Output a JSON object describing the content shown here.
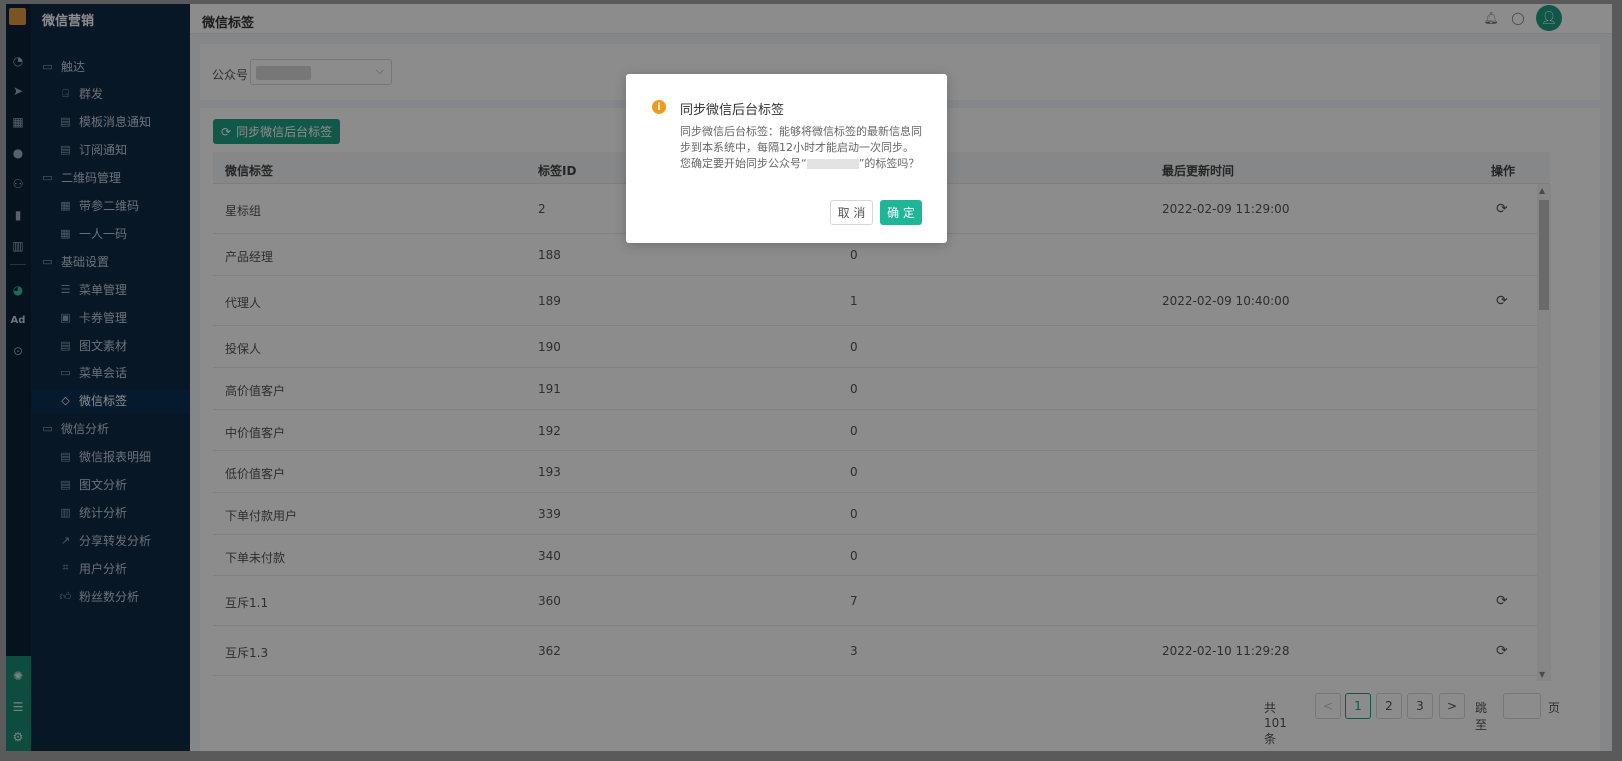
{
  "app": {
    "brand": "微信营销",
    "page_title": "微信标签"
  },
  "rail_icons": [
    "dashboard-icon",
    "send-icon",
    "calendar-icon",
    "user-icon",
    "users-icon",
    "bookmark-icon",
    "bar-chart-icon",
    "wechat-icon",
    "ad-icon",
    "circle-icon",
    "hub-icon",
    "list-icon",
    "gear-icon"
  ],
  "rail": {
    "ad_label": "Ad"
  },
  "sidebar": {
    "items": [
      {
        "label": "触达",
        "type": "group",
        "icon": "folder-icon"
      },
      {
        "label": "群发",
        "type": "child",
        "icon": "broadcast-icon"
      },
      {
        "label": "模板消息通知",
        "type": "child",
        "icon": "template-icon"
      },
      {
        "label": "订阅通知",
        "type": "child",
        "icon": "subscribe-icon"
      },
      {
        "label": "二维码管理",
        "type": "group",
        "icon": "folder-icon"
      },
      {
        "label": "带参二维码",
        "type": "child",
        "icon": "qrcode-icon"
      },
      {
        "label": "一人一码",
        "type": "child",
        "icon": "qrcode-person-icon"
      },
      {
        "label": "基础设置",
        "type": "group",
        "icon": "folder-icon"
      },
      {
        "label": "菜单管理",
        "type": "child",
        "icon": "menu-icon"
      },
      {
        "label": "卡券管理",
        "type": "child",
        "icon": "coupon-icon"
      },
      {
        "label": "图文素材",
        "type": "child",
        "icon": "article-icon"
      },
      {
        "label": "菜单会话",
        "type": "child",
        "icon": "chat-icon"
      },
      {
        "label": "微信标签",
        "type": "child",
        "icon": "tag-icon",
        "selected": true
      },
      {
        "label": "微信分析",
        "type": "group",
        "icon": "folder-icon"
      },
      {
        "label": "微信报表明细",
        "type": "child",
        "icon": "report-icon"
      },
      {
        "label": "图文分析",
        "type": "child",
        "icon": "article-analysis-icon"
      },
      {
        "label": "统计分析",
        "type": "child",
        "icon": "stats-icon"
      },
      {
        "label": "分享转发分析",
        "type": "child",
        "icon": "share-icon"
      },
      {
        "label": "用户分析",
        "type": "child",
        "icon": "user-scan-icon"
      },
      {
        "label": "粉丝数分析",
        "type": "child",
        "icon": "thumbs-up-icon"
      }
    ]
  },
  "filter": {
    "account_label": "公众号",
    "account_value": ""
  },
  "toolbar": {
    "sync_label": "同步微信后台标签"
  },
  "table": {
    "columns": [
      "微信标签",
      "标签ID",
      "",
      "最后更新时间",
      "操作"
    ],
    "rows": [
      {
        "name": "星标组",
        "id": "2",
        "count": "",
        "updated": "2022-02-09 11:29:00",
        "action": true
      },
      {
        "name": "产品经理",
        "id": "188",
        "count": "0",
        "updated": "",
        "action": false
      },
      {
        "name": "代理人",
        "id": "189",
        "count": "1",
        "updated": "2022-02-09 10:40:00",
        "action": true
      },
      {
        "name": "投保人",
        "id": "190",
        "count": "0",
        "updated": "",
        "action": false
      },
      {
        "name": "高价值客户",
        "id": "191",
        "count": "0",
        "updated": "",
        "action": false
      },
      {
        "name": "中价值客户",
        "id": "192",
        "count": "0",
        "updated": "",
        "action": false
      },
      {
        "name": "低价值客户",
        "id": "193",
        "count": "0",
        "updated": "",
        "action": false
      },
      {
        "name": "下单付款用户",
        "id": "339",
        "count": "0",
        "updated": "",
        "action": false
      },
      {
        "name": "下单未付款",
        "id": "340",
        "count": "0",
        "updated": "",
        "action": false
      },
      {
        "name": "互斥1.1",
        "id": "360",
        "count": "7",
        "updated": "",
        "action": true
      },
      {
        "name": "互斥1.3",
        "id": "362",
        "count": "3",
        "updated": "2022-02-10 11:29:28",
        "action": true
      }
    ]
  },
  "pagination": {
    "total": "共 101 条",
    "prev": "<",
    "pages": [
      "1",
      "2",
      "3"
    ],
    "current": "1",
    "next": ">",
    "jump_label": "跳至",
    "page_unit": "页"
  },
  "modal": {
    "title": "同步微信后台标签",
    "body_before": "同步微信后台标签：能够将微信标签的最新信息同步到本系统中，每隔12小时才能启动一次同步。您确定要开始同步公众号“",
    "body_after": "”的标签吗？",
    "cancel_label": "取 消",
    "ok_label": "确 定"
  },
  "colors": {
    "accent": "#1fa085",
    "sidebar_bg": "#102a45",
    "warning": "#f29a1c"
  }
}
